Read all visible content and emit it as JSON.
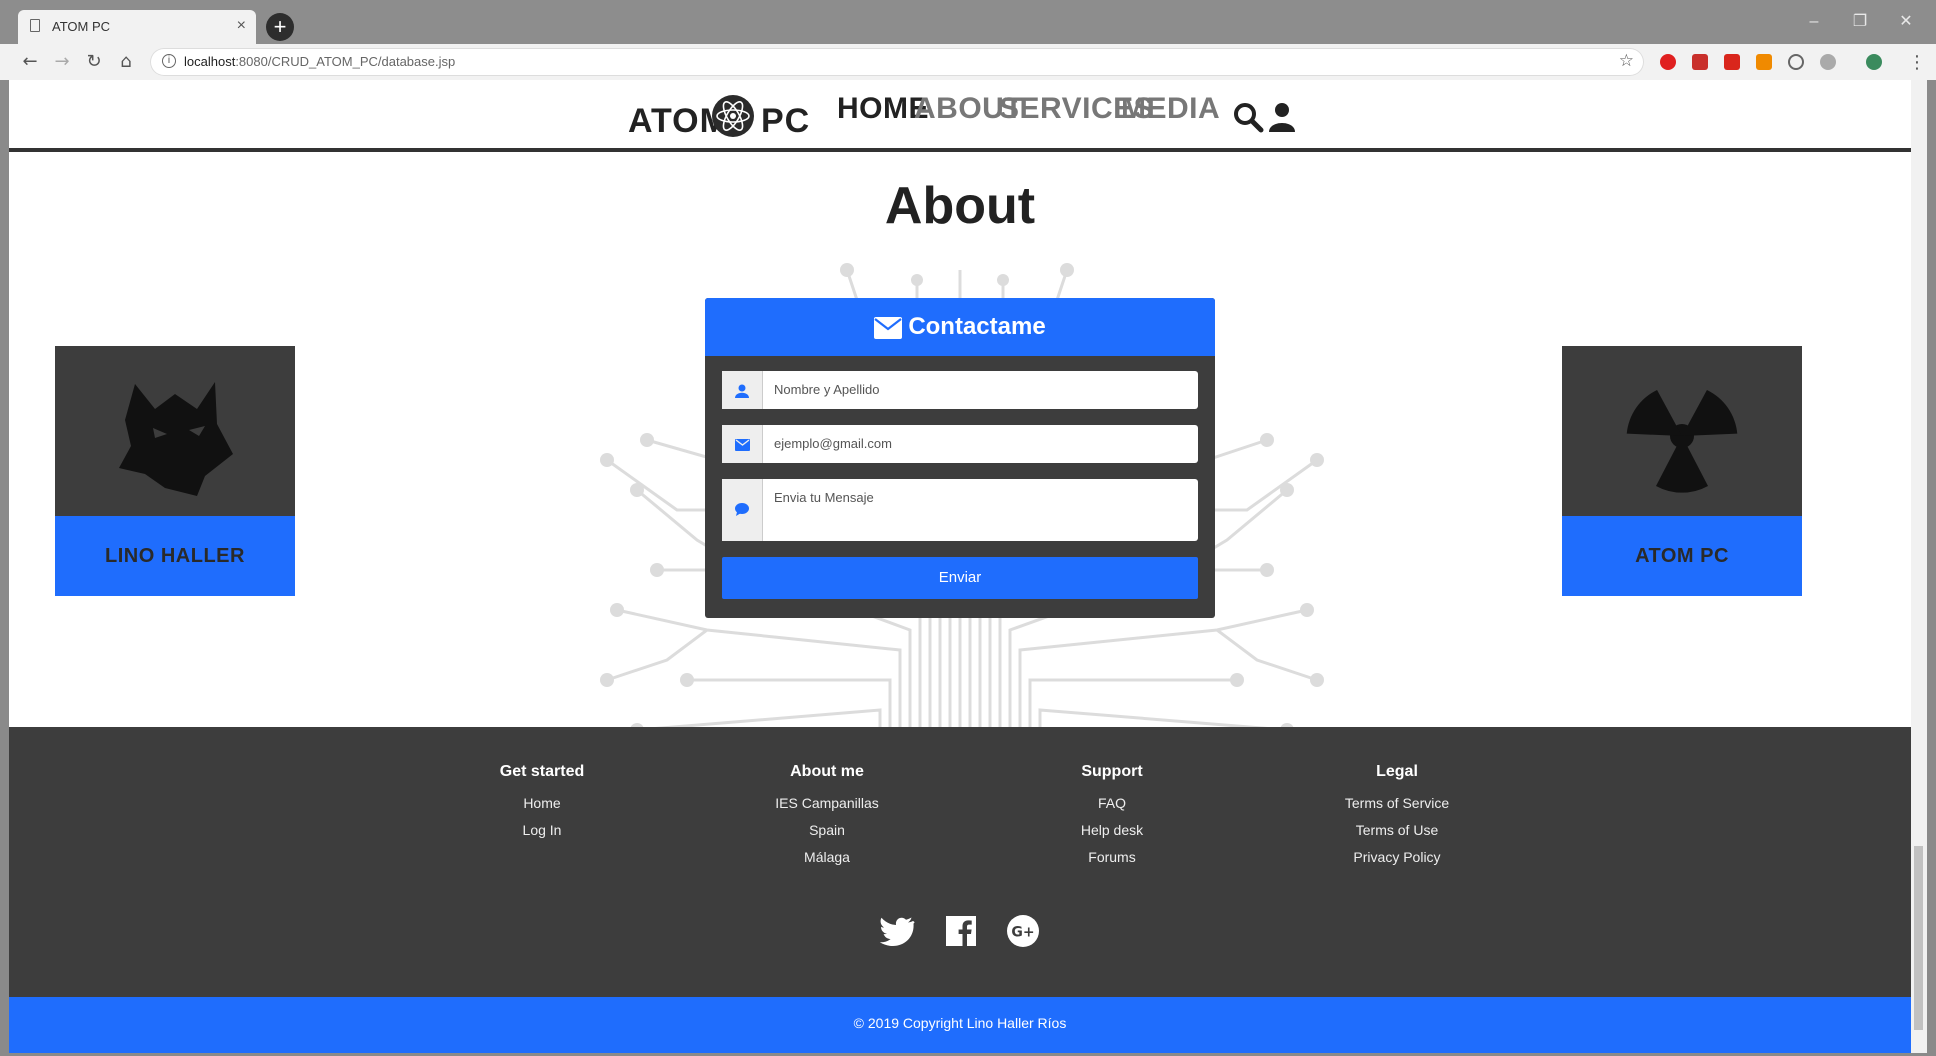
{
  "browser": {
    "tab_title": "ATOM PC",
    "tab_close": "×",
    "new_tab": "+",
    "url_host": "localhost",
    "url_path": ":8080/CRUD_ATOM_PC/database.jsp",
    "window_min": "–",
    "window_max": "❐",
    "window_close": "✕",
    "back": "←",
    "forward": "→",
    "reload": "↻",
    "home": "⌂",
    "bookmark": "☆",
    "menu": "⋮"
  },
  "header": {
    "logo_left": "ATOM",
    "logo_right": "PC",
    "nav": [
      {
        "label": "HOME",
        "active": true
      },
      {
        "label": "ABOUT",
        "active": false
      },
      {
        "label": "SERVICES",
        "active": false
      },
      {
        "label": "MEDIA",
        "active": false
      }
    ]
  },
  "main": {
    "title": "About",
    "cards": [
      {
        "label": "LINO HALLER",
        "icon": "wolf-icon"
      },
      {
        "label": "ATOM PC",
        "icon": "radiation-icon"
      }
    ],
    "form": {
      "title": "Contactame",
      "name_placeholder": "Nombre y Apellido",
      "email_placeholder": "ejemplo@gmail.com",
      "message_placeholder": "Envia tu Mensaje",
      "submit_label": "Enviar"
    }
  },
  "footer": {
    "columns": [
      {
        "title": "Get started",
        "links": [
          "Home",
          "Log In"
        ]
      },
      {
        "title": "About me",
        "links": [
          "IES Campanillas",
          "Spain",
          "Málaga"
        ]
      },
      {
        "title": "Support",
        "links": [
          "FAQ",
          "Help desk",
          "Forums"
        ]
      },
      {
        "title": "Legal",
        "links": [
          "Terms of Service",
          "Terms of Use",
          "Privacy Policy"
        ]
      }
    ],
    "social": [
      "twitter-icon",
      "facebook-icon",
      "google-plus-icon"
    ],
    "copyright": "© 2019 Copyright Lino Haller Ríos"
  },
  "colors": {
    "accent": "#1f6dfd",
    "dark": "#3d3d3d"
  }
}
